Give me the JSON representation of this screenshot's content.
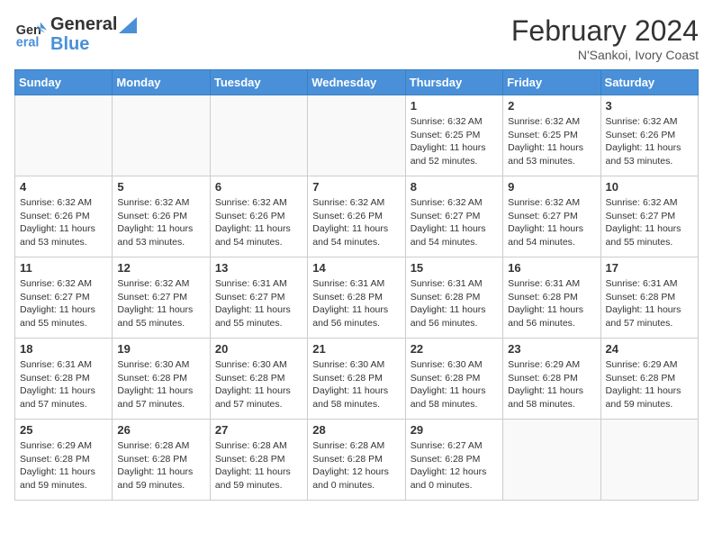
{
  "header": {
    "logo_line1": "General",
    "logo_line2": "Blue",
    "month_title": "February 2024",
    "subtitle": "N'Sankoi, Ivory Coast"
  },
  "weekdays": [
    "Sunday",
    "Monday",
    "Tuesday",
    "Wednesday",
    "Thursday",
    "Friday",
    "Saturday"
  ],
  "weeks": [
    [
      {
        "day": "",
        "info": ""
      },
      {
        "day": "",
        "info": ""
      },
      {
        "day": "",
        "info": ""
      },
      {
        "day": "",
        "info": ""
      },
      {
        "day": "1",
        "info": "Sunrise: 6:32 AM\nSunset: 6:25 PM\nDaylight: 11 hours and 52 minutes."
      },
      {
        "day": "2",
        "info": "Sunrise: 6:32 AM\nSunset: 6:25 PM\nDaylight: 11 hours and 53 minutes."
      },
      {
        "day": "3",
        "info": "Sunrise: 6:32 AM\nSunset: 6:26 PM\nDaylight: 11 hours and 53 minutes."
      }
    ],
    [
      {
        "day": "4",
        "info": "Sunrise: 6:32 AM\nSunset: 6:26 PM\nDaylight: 11 hours and 53 minutes."
      },
      {
        "day": "5",
        "info": "Sunrise: 6:32 AM\nSunset: 6:26 PM\nDaylight: 11 hours and 53 minutes."
      },
      {
        "day": "6",
        "info": "Sunrise: 6:32 AM\nSunset: 6:26 PM\nDaylight: 11 hours and 54 minutes."
      },
      {
        "day": "7",
        "info": "Sunrise: 6:32 AM\nSunset: 6:26 PM\nDaylight: 11 hours and 54 minutes."
      },
      {
        "day": "8",
        "info": "Sunrise: 6:32 AM\nSunset: 6:27 PM\nDaylight: 11 hours and 54 minutes."
      },
      {
        "day": "9",
        "info": "Sunrise: 6:32 AM\nSunset: 6:27 PM\nDaylight: 11 hours and 54 minutes."
      },
      {
        "day": "10",
        "info": "Sunrise: 6:32 AM\nSunset: 6:27 PM\nDaylight: 11 hours and 55 minutes."
      }
    ],
    [
      {
        "day": "11",
        "info": "Sunrise: 6:32 AM\nSunset: 6:27 PM\nDaylight: 11 hours and 55 minutes."
      },
      {
        "day": "12",
        "info": "Sunrise: 6:32 AM\nSunset: 6:27 PM\nDaylight: 11 hours and 55 minutes."
      },
      {
        "day": "13",
        "info": "Sunrise: 6:31 AM\nSunset: 6:27 PM\nDaylight: 11 hours and 55 minutes."
      },
      {
        "day": "14",
        "info": "Sunrise: 6:31 AM\nSunset: 6:28 PM\nDaylight: 11 hours and 56 minutes."
      },
      {
        "day": "15",
        "info": "Sunrise: 6:31 AM\nSunset: 6:28 PM\nDaylight: 11 hours and 56 minutes."
      },
      {
        "day": "16",
        "info": "Sunrise: 6:31 AM\nSunset: 6:28 PM\nDaylight: 11 hours and 56 minutes."
      },
      {
        "day": "17",
        "info": "Sunrise: 6:31 AM\nSunset: 6:28 PM\nDaylight: 11 hours and 57 minutes."
      }
    ],
    [
      {
        "day": "18",
        "info": "Sunrise: 6:31 AM\nSunset: 6:28 PM\nDaylight: 11 hours and 57 minutes."
      },
      {
        "day": "19",
        "info": "Sunrise: 6:30 AM\nSunset: 6:28 PM\nDaylight: 11 hours and 57 minutes."
      },
      {
        "day": "20",
        "info": "Sunrise: 6:30 AM\nSunset: 6:28 PM\nDaylight: 11 hours and 57 minutes."
      },
      {
        "day": "21",
        "info": "Sunrise: 6:30 AM\nSunset: 6:28 PM\nDaylight: 11 hours and 58 minutes."
      },
      {
        "day": "22",
        "info": "Sunrise: 6:30 AM\nSunset: 6:28 PM\nDaylight: 11 hours and 58 minutes."
      },
      {
        "day": "23",
        "info": "Sunrise: 6:29 AM\nSunset: 6:28 PM\nDaylight: 11 hours and 58 minutes."
      },
      {
        "day": "24",
        "info": "Sunrise: 6:29 AM\nSunset: 6:28 PM\nDaylight: 11 hours and 59 minutes."
      }
    ],
    [
      {
        "day": "25",
        "info": "Sunrise: 6:29 AM\nSunset: 6:28 PM\nDaylight: 11 hours and 59 minutes."
      },
      {
        "day": "26",
        "info": "Sunrise: 6:28 AM\nSunset: 6:28 PM\nDaylight: 11 hours and 59 minutes."
      },
      {
        "day": "27",
        "info": "Sunrise: 6:28 AM\nSunset: 6:28 PM\nDaylight: 11 hours and 59 minutes."
      },
      {
        "day": "28",
        "info": "Sunrise: 6:28 AM\nSunset: 6:28 PM\nDaylight: 12 hours and 0 minutes."
      },
      {
        "day": "29",
        "info": "Sunrise: 6:27 AM\nSunset: 6:28 PM\nDaylight: 12 hours and 0 minutes."
      },
      {
        "day": "",
        "info": ""
      },
      {
        "day": "",
        "info": ""
      }
    ]
  ]
}
